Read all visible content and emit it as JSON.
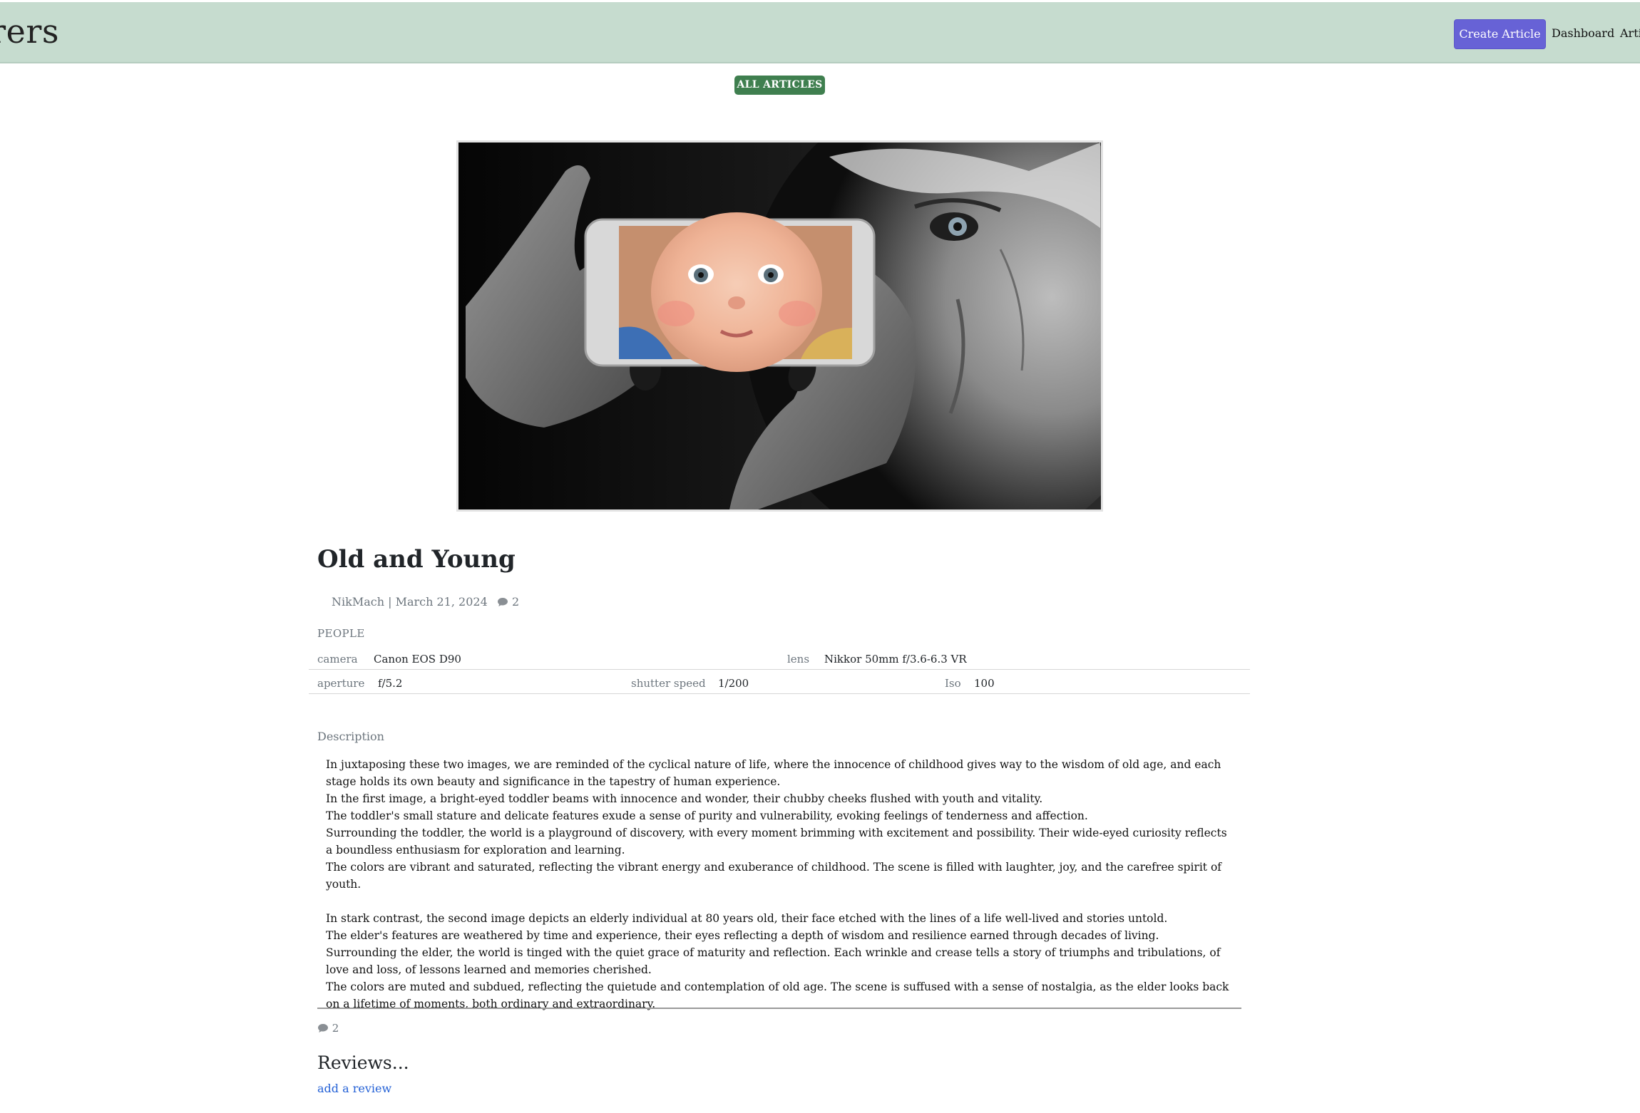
{
  "nav": {
    "brand": "urers",
    "create_label": "Create Article",
    "dashboard_label": "Dashboard",
    "articles_label": "Arti",
    "accent": "#6762d6",
    "bar_color": "#c6dccf"
  },
  "badge": {
    "label": "ALL ARTICLES",
    "color": "#3f7f4f"
  },
  "article": {
    "title": "Old and Young",
    "author": "NikMach",
    "separator": "|",
    "date": "March 21, 2024",
    "comment_count": "2",
    "category": "PEOPLE",
    "specs": {
      "camera_label": "camera",
      "camera": "Canon EOS D90",
      "lens_label": "lens",
      "lens": "Nikkor 50mm f/3.6-6.3 VR",
      "aperture_label": "aperture",
      "aperture": "f/5.2",
      "shutter_label": "shutter speed",
      "shutter": "1/200",
      "iso_label": "Iso",
      "iso": "100"
    },
    "description_label": "Description",
    "description": {
      "p1": "In juxtaposing these two images, we are reminded of the cyclical nature of life, where the innocence of childhood gives way to the wisdom of old age, and each stage holds its own beauty and significance in the tapestry of human experience.",
      "p2": "In the first image, a bright-eyed toddler beams with innocence and wonder, their chubby cheeks flushed with youth and vitality.",
      "p3": "The toddler's small stature and delicate features exude a sense of purity and vulnerability, evoking feelings of tenderness and affection.",
      "p4": "Surrounding the toddler, the world is a playground of discovery, with every moment brimming with excitement and possibility. Their wide-eyed curiosity reflects a boundless enthusiasm for exploration and learning.",
      "p5": "The colors are vibrant and saturated, reflecting the vibrant energy and exuberance of childhood. The scene is filled with laughter, joy, and the carefree spirit of youth.",
      "p6": "In stark contrast, the second image depicts an elderly individual at 80 years old, their face etched with the lines of a life well-lived and stories untold.",
      "p7": "The elder's features are weathered by time and experience, their eyes reflecting a depth of wisdom and resilience earned through decades of living.",
      "p8": "Surrounding the elder, the world is tinged with the quiet grace of maturity and reflection. Each wrinkle and crease tells a story of triumphs and tribulations, of love and loss, of lessons learned and memories cherished.",
      "p9": "The colors are muted and subdued, reflecting the quietude and contemplation of old age. The scene is suffused with a sense of nostalgia, as the elder looks back on a lifetime of moments, both ordinary and extraordinary."
    }
  },
  "footer": {
    "comment_count": "2",
    "reviews_heading": "Reviews...",
    "add_review_label": "add a review",
    "link_color": "#2461d6"
  },
  "icons": {
    "comment": "speech-bubble-icon"
  }
}
